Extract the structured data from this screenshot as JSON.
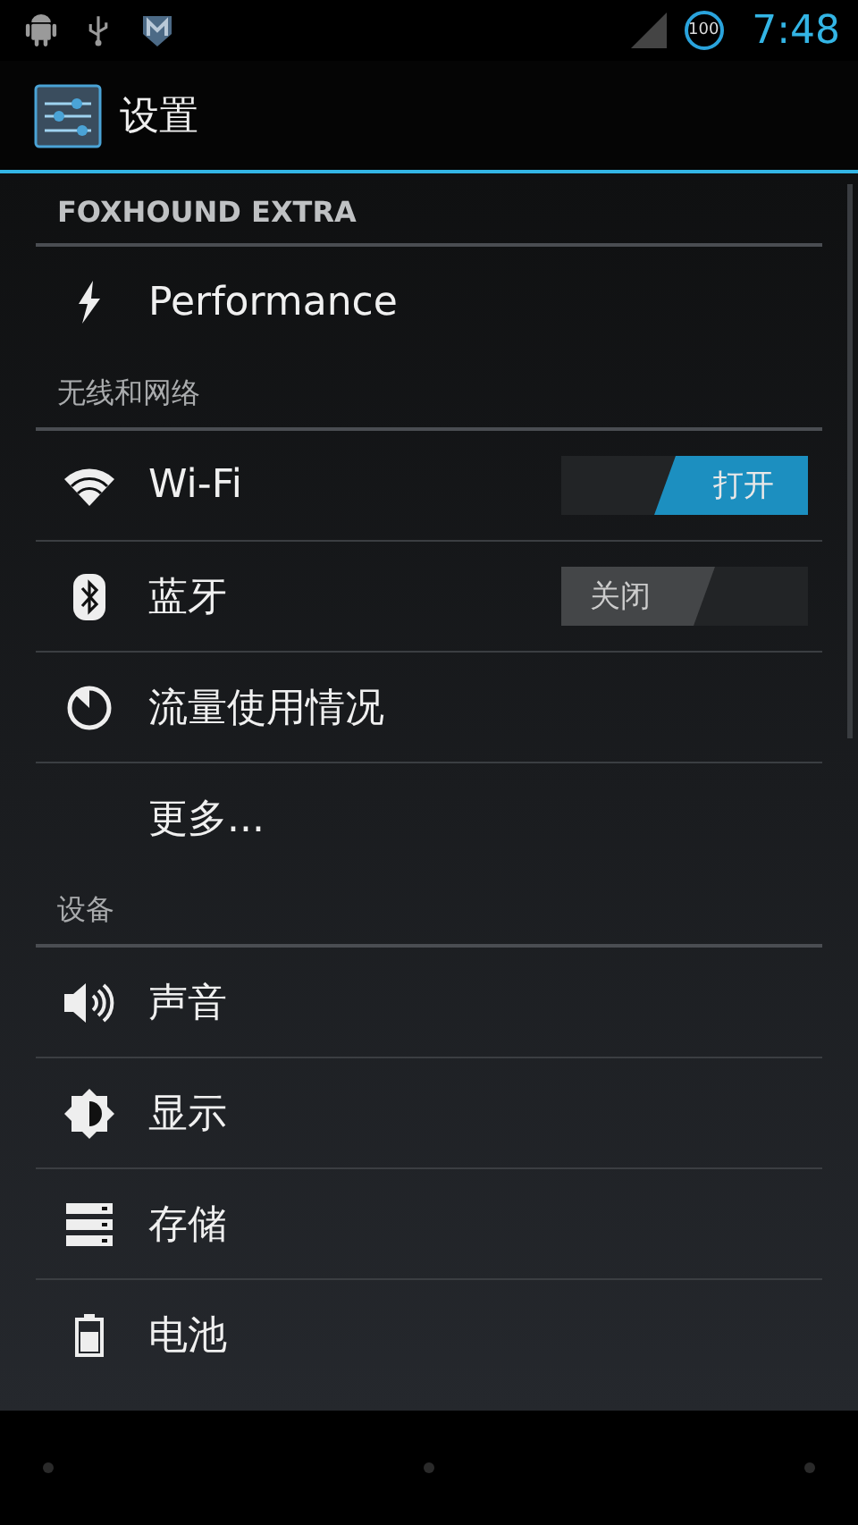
{
  "status_bar": {
    "battery": "100",
    "time": "7:48"
  },
  "action_bar": {
    "title": "设置"
  },
  "list": [
    {
      "kind": "header",
      "label": "FOXHOUND EXTRA",
      "bold": true
    },
    {
      "kind": "item",
      "label": "Performance"
    },
    {
      "kind": "header",
      "label": "无线和网络",
      "bold": false
    },
    {
      "kind": "item",
      "label": "Wi-Fi",
      "toggle": {
        "label": "打开",
        "on": true
      }
    },
    {
      "kind": "item",
      "label": "蓝牙",
      "toggle": {
        "label": "关闭",
        "on": false
      }
    },
    {
      "kind": "item",
      "label": "流量使用情况"
    },
    {
      "kind": "item",
      "label": "更多..."
    },
    {
      "kind": "header",
      "label": "设备",
      "bold": false
    },
    {
      "kind": "item",
      "label": "声音"
    },
    {
      "kind": "item",
      "label": "显示"
    },
    {
      "kind": "item",
      "label": "存储"
    },
    {
      "kind": "item",
      "label": "电池"
    }
  ]
}
